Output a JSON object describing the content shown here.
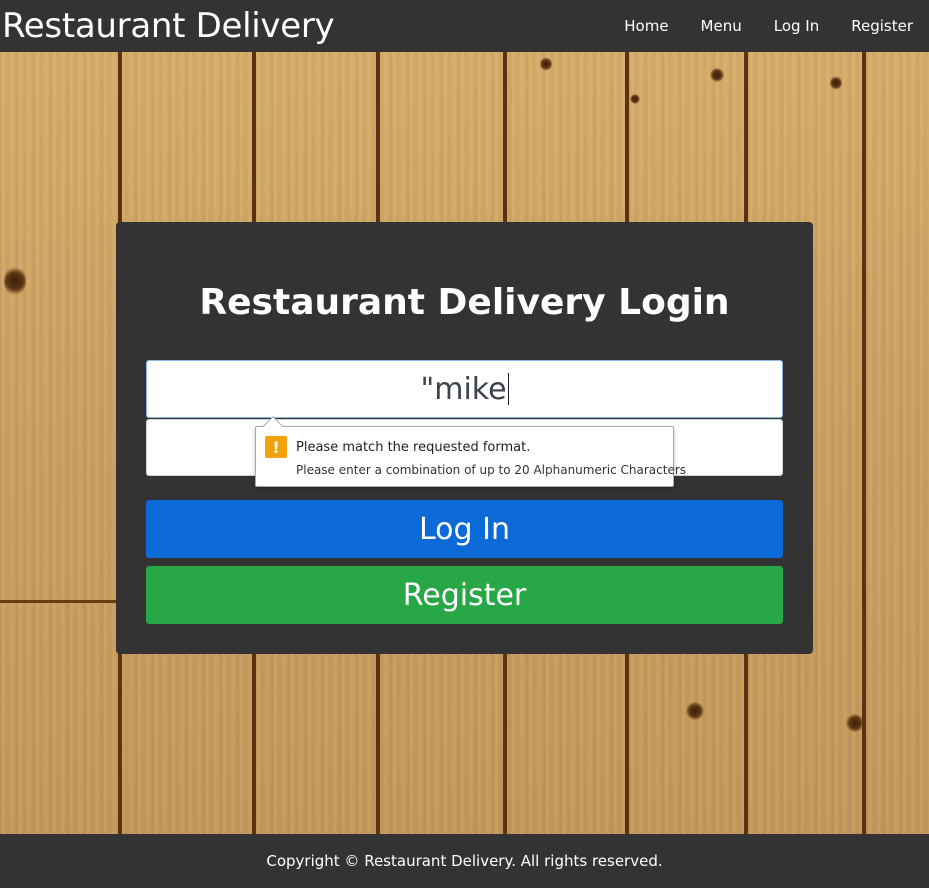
{
  "navbar": {
    "brand": "Restaurant Delivery",
    "links": [
      "Home",
      "Menu",
      "Log In",
      "Register"
    ]
  },
  "login": {
    "title": "Restaurant Delivery Login",
    "username_value": "\"mike",
    "password_value": "",
    "login_button": "Log In",
    "register_button": "Register"
  },
  "validation_tooltip": {
    "icon": "warning-icon",
    "message": "Please match the requested format.",
    "detail": "Please enter a combination of up to 20 Alphanumeric Characters"
  },
  "footer": {
    "copyright": "Copyright © Restaurant Delivery. All rights reserved."
  },
  "colors": {
    "dark": "#333333",
    "primary": "#0b69d8",
    "success": "#27a745",
    "warning": "#f3a20b",
    "wood": "#c99a55"
  }
}
